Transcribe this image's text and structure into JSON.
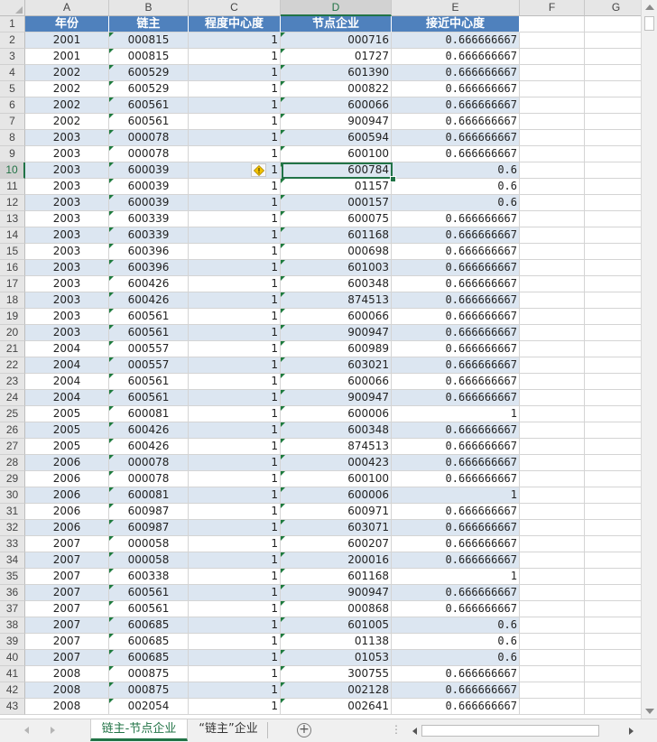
{
  "columns": [
    {
      "letter": "A",
      "w": 93
    },
    {
      "letter": "B",
      "w": 88
    },
    {
      "letter": "C",
      "w": 102
    },
    {
      "letter": "D",
      "w": 123
    },
    {
      "letter": "E",
      "w": 142
    },
    {
      "letter": "F",
      "w": 72
    },
    {
      "letter": "G",
      "w": 70
    }
  ],
  "selected_cell": "D10",
  "header": [
    "年份",
    "链主",
    "程度中心度",
    "节点企业",
    "接近中心度"
  ],
  "rows": [
    [
      "2001",
      "000815",
      "1",
      "000716",
      "0.666666667"
    ],
    [
      "2001",
      "000815",
      "1",
      "01727",
      "0.666666667"
    ],
    [
      "2002",
      "600529",
      "1",
      "601390",
      "0.666666667"
    ],
    [
      "2002",
      "600529",
      "1",
      "000822",
      "0.666666667"
    ],
    [
      "2002",
      "600561",
      "1",
      "600066",
      "0.666666667"
    ],
    [
      "2002",
      "600561",
      "1",
      "900947",
      "0.666666667"
    ],
    [
      "2003",
      "000078",
      "1",
      "600594",
      "0.666666667"
    ],
    [
      "2003",
      "000078",
      "1",
      "600100",
      "0.666666667"
    ],
    [
      "2003",
      "600039",
      "1",
      "600784",
      "0.6"
    ],
    [
      "2003",
      "600039",
      "1",
      "01157",
      "0.6"
    ],
    [
      "2003",
      "600039",
      "1",
      "000157",
      "0.6"
    ],
    [
      "2003",
      "600339",
      "1",
      "600075",
      "0.666666667"
    ],
    [
      "2003",
      "600339",
      "1",
      "601168",
      "0.666666667"
    ],
    [
      "2003",
      "600396",
      "1",
      "000698",
      "0.666666667"
    ],
    [
      "2003",
      "600396",
      "1",
      "601003",
      "0.666666667"
    ],
    [
      "2003",
      "600426",
      "1",
      "600348",
      "0.666666667"
    ],
    [
      "2003",
      "600426",
      "1",
      "874513",
      "0.666666667"
    ],
    [
      "2003",
      "600561",
      "1",
      "600066",
      "0.666666667"
    ],
    [
      "2003",
      "600561",
      "1",
      "900947",
      "0.666666667"
    ],
    [
      "2004",
      "000557",
      "1",
      "600989",
      "0.666666667"
    ],
    [
      "2004",
      "000557",
      "1",
      "603021",
      "0.666666667"
    ],
    [
      "2004",
      "600561",
      "1",
      "600066",
      "0.666666667"
    ],
    [
      "2004",
      "600561",
      "1",
      "900947",
      "0.666666667"
    ],
    [
      "2005",
      "600081",
      "1",
      "600006",
      "1"
    ],
    [
      "2005",
      "600426",
      "1",
      "600348",
      "0.666666667"
    ],
    [
      "2005",
      "600426",
      "1",
      "874513",
      "0.666666667"
    ],
    [
      "2006",
      "000078",
      "1",
      "000423",
      "0.666666667"
    ],
    [
      "2006",
      "000078",
      "1",
      "600100",
      "0.666666667"
    ],
    [
      "2006",
      "600081",
      "1",
      "600006",
      "1"
    ],
    [
      "2006",
      "600987",
      "1",
      "600971",
      "0.666666667"
    ],
    [
      "2006",
      "600987",
      "1",
      "603071",
      "0.666666667"
    ],
    [
      "2007",
      "000058",
      "1",
      "600207",
      "0.666666667"
    ],
    [
      "2007",
      "000058",
      "1",
      "200016",
      "0.666666667"
    ],
    [
      "2007",
      "600338",
      "1",
      "601168",
      "1"
    ],
    [
      "2007",
      "600561",
      "1",
      "900947",
      "0.666666667"
    ],
    [
      "2007",
      "600561",
      "1",
      "000868",
      "0.666666667"
    ],
    [
      "2007",
      "600685",
      "1",
      "601005",
      "0.6"
    ],
    [
      "2007",
      "600685",
      "1",
      "01138",
      "0.6"
    ],
    [
      "2007",
      "600685",
      "1",
      "01053",
      "0.6"
    ],
    [
      "2008",
      "000875",
      "1",
      "300755",
      "0.666666667"
    ],
    [
      "2008",
      "000875",
      "1",
      "002128",
      "0.666666667"
    ],
    [
      "2008",
      "002054",
      "1",
      "002641",
      "0.666666667"
    ]
  ],
  "sheet_tabs": [
    "链主-节点企业",
    "“链主”企业"
  ],
  "add_sheet_symbol": "+",
  "tab_dots": "⋮"
}
